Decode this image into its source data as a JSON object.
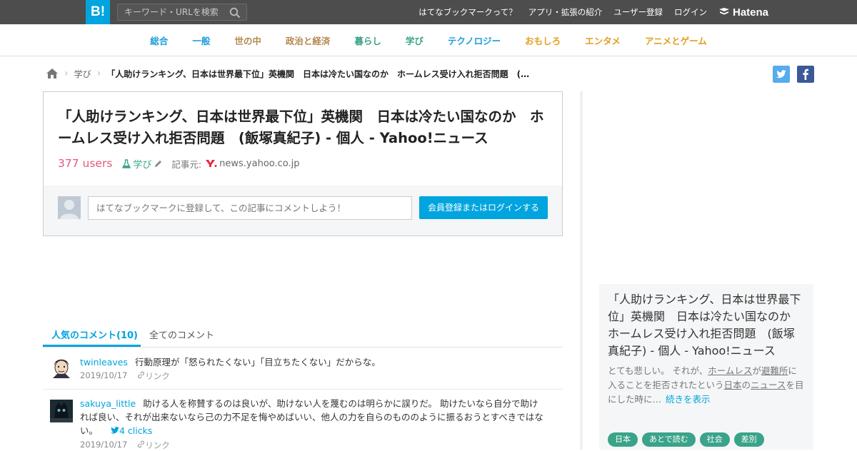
{
  "topbar": {
    "logo": "B!",
    "search_placeholder": "キーワード・URLを検索",
    "links": [
      "はてなブックマークって？",
      "アプリ・拡張の紹介",
      "ユーザー登録",
      "ログイン"
    ],
    "brand": "Hatena"
  },
  "categories": [
    {
      "label": "総合",
      "color": "#1a9dd9"
    },
    {
      "label": "一般",
      "color": "#1a9dd9"
    },
    {
      "label": "世の中",
      "color": "#b4884e"
    },
    {
      "label": "政治と経済",
      "color": "#b4884e"
    },
    {
      "label": "暮らし",
      "color": "#3aa38a"
    },
    {
      "label": "学び",
      "color": "#3aa38a"
    },
    {
      "label": "テクノロジー",
      "color": "#1a9dd9"
    },
    {
      "label": "おもしろ",
      "color": "#e0a01e"
    },
    {
      "label": "エンタメ",
      "color": "#e0a01e"
    },
    {
      "label": "アニメとゲーム",
      "color": "#e0a01e"
    }
  ],
  "breadcrumb": {
    "category": "学び",
    "title": "「人助けランキング、日本は世界最下位」英機関　日本は冷たい国なのか　ホームレス受け入れ拒否問題　(飯塚真紀子) - 個人 - Yahoo!ニュース"
  },
  "entry": {
    "title": "「人助けランキング、日本は世界最下位」英機関　日本は冷たい国なのか　ホームレス受け入れ拒否問題　(飯塚真紀子) - 個人 - Yahoo!ニュース",
    "users": "377 users",
    "category": "学び",
    "source_label": "記事元:",
    "source": "news.yahoo.co.jp",
    "comment_placeholder": "はてなブックマークに登録して、この記事にコメントしよう！",
    "login_button": "会員登録またはログインする"
  },
  "tabs": {
    "popular": "人気のコメント(10)",
    "all": "全てのコメント"
  },
  "comments": [
    {
      "user": "twinleaves",
      "text": "行動原理が「怒られたくない」「目立ちたくない」だからな。",
      "date": "2019/10/17",
      "link": "リンク"
    },
    {
      "user": "sakuya_little",
      "text": "助ける人を称賛するのは良いが、助けない人を蔑むのは明らかに誤りだ。 助けたいなら自分で助ければ良い、それが出来ないなら己の力不足を悔やめばいい、他人の力を自らのもののように振るおうとすべきではない。",
      "clicks": "4 clicks",
      "date": "2019/10/17",
      "link": "リンク"
    }
  ],
  "sidebar": {
    "title": "「人助けランキング、日本は世界最下位」英機関　日本は冷たい国なのか　ホームレス受け入れ拒否問題　(飯塚真紀子) - 個人 - Yahoo!ニュース",
    "desc_1": "とても悲しい。 それが、",
    "desc_2": "ホームレス",
    "desc_3": "が",
    "desc_4": "避難所",
    "desc_5": "に入ることを拒否されたという",
    "desc_6": "日本",
    "desc_7": "の",
    "desc_8": "ニュース",
    "desc_9": "を目にした時に…",
    "more": "続きを表示",
    "tags": [
      "日本",
      "あとで読む",
      "社会",
      "差別"
    ]
  },
  "colors": {
    "accent": "#00a4de",
    "users": "#e5597a",
    "topbar": "#4d4d4d",
    "twitter": "#55acee",
    "facebook": "#3b5998",
    "tag": "#3aa38a"
  }
}
